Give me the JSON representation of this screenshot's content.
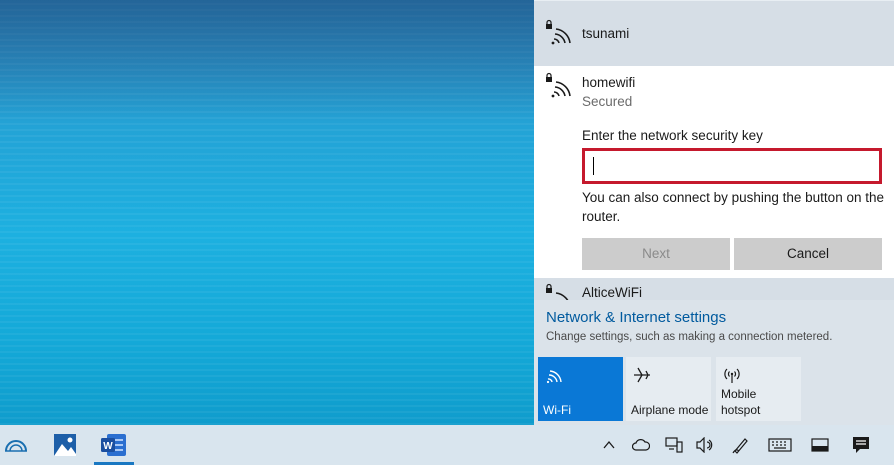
{
  "networks": [
    {
      "name": "tsunami",
      "icon": "secured-wifi-icon"
    },
    {
      "name": "homewifi",
      "status": "Secured",
      "icon": "secured-wifi-icon"
    },
    {
      "name": "AlticeWiFi",
      "icon": "secured-wifi-icon"
    }
  ],
  "connect_form": {
    "label": "Enter the network security key",
    "value": "",
    "hint": "You can also connect by pushing the button on the router.",
    "next_label": "Next",
    "cancel_label": "Cancel"
  },
  "settings": {
    "title": "Network & Internet settings",
    "subtitle": "Change settings, such as making a connection metered."
  },
  "quick_actions": [
    {
      "label": "Wi-Fi",
      "icon": "wifi-icon",
      "active": true
    },
    {
      "label": "Airplane mode",
      "icon": "airplane-icon",
      "active": false
    },
    {
      "label_line1": "Mobile",
      "label_line2": "hotspot",
      "icon": "hotspot-icon",
      "active": false
    }
  ],
  "taskbar": {
    "apps": [
      "edge-icon",
      "photos-icon",
      "word-icon"
    ],
    "tray": [
      "chevron-up-icon",
      "onedrive-icon",
      "network-icon",
      "volume-icon",
      "pen-icon",
      "keyboard-icon",
      "tablet-icon",
      "notifications-icon"
    ]
  },
  "colors": {
    "accent": "#0a78d6",
    "link": "#005a9e",
    "input_border": "#c5192d"
  }
}
